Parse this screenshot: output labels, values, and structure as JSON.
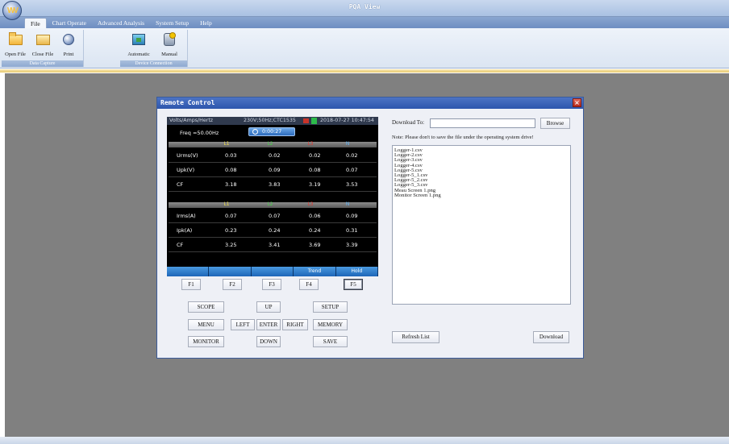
{
  "app": {
    "title": "PQA View"
  },
  "menu": [
    "File",
    "Chart Operate",
    "Advanced Analysis",
    "System Setup",
    "Help"
  ],
  "ribbon": {
    "data_capture": {
      "label": "Data Capture",
      "buttons": [
        "Open File",
        "Close File",
        "Print"
      ]
    },
    "device_connection": {
      "label": "Device Connection",
      "buttons": [
        "Automatic",
        "Manual"
      ]
    }
  },
  "dialog": {
    "title": "Remote Control",
    "screen": {
      "mode": "Volts/Amps/Hertz",
      "spec": "230V;50Hz;CTC1535",
      "datetime": "2018-07-27 10:47:54",
      "freq": "Freq =50.00Hz",
      "timer": "0:00:27",
      "phases": [
        "L1",
        "L2",
        "L3",
        "N"
      ],
      "voltage_rows": [
        {
          "label": "Urms(V)",
          "values": [
            "0.03",
            "0.02",
            "0.02",
            "0.02"
          ]
        },
        {
          "label": "Upk(V)",
          "values": [
            "0.08",
            "0.09",
            "0.08",
            "0.07"
          ]
        },
        {
          "label": "CF",
          "values": [
            "3.18",
            "3.83",
            "3.19",
            "3.53"
          ]
        }
      ],
      "current_rows": [
        {
          "label": "Irms(A)",
          "values": [
            "0.07",
            "0.07",
            "0.06",
            "0.09"
          ]
        },
        {
          "label": "Ipk(A)",
          "values": [
            "0.23",
            "0.24",
            "0.24",
            "0.31"
          ]
        },
        {
          "label": "CF",
          "values": [
            "3.25",
            "3.41",
            "3.69",
            "3.39"
          ]
        }
      ],
      "function_bar": [
        "",
        "",
        "",
        "Trend",
        "Hold"
      ]
    },
    "fkeys": [
      "F1",
      "F2",
      "F3",
      "F4",
      "F5"
    ],
    "keys": {
      "scope": "SCOPE",
      "up": "UP",
      "setup": "SETUP",
      "menu": "MENU",
      "left": "LEFT",
      "enter": "ENTER",
      "right": "RIGHT",
      "memory": "MEMORY",
      "monitor": "MONITOR",
      "down": "DOWN",
      "save": "SAVE"
    },
    "download_label": "Download To:",
    "download_path": "",
    "browse": "Browse",
    "note": "Note: Please don't to save the file under the operating system drive!",
    "files": [
      "Logger-1.csv",
      "Logger-2.csv",
      "Logger-3.csv",
      "Logger-4.csv",
      "Logger-5.csv",
      "Logger-5_1.csv",
      "Logger-5_2.csv",
      "Logger-5_3.csv",
      "Meau Screen 1.png",
      "Monitor Screen 1.png"
    ],
    "refresh": "Refresh List",
    "download": "Download"
  }
}
